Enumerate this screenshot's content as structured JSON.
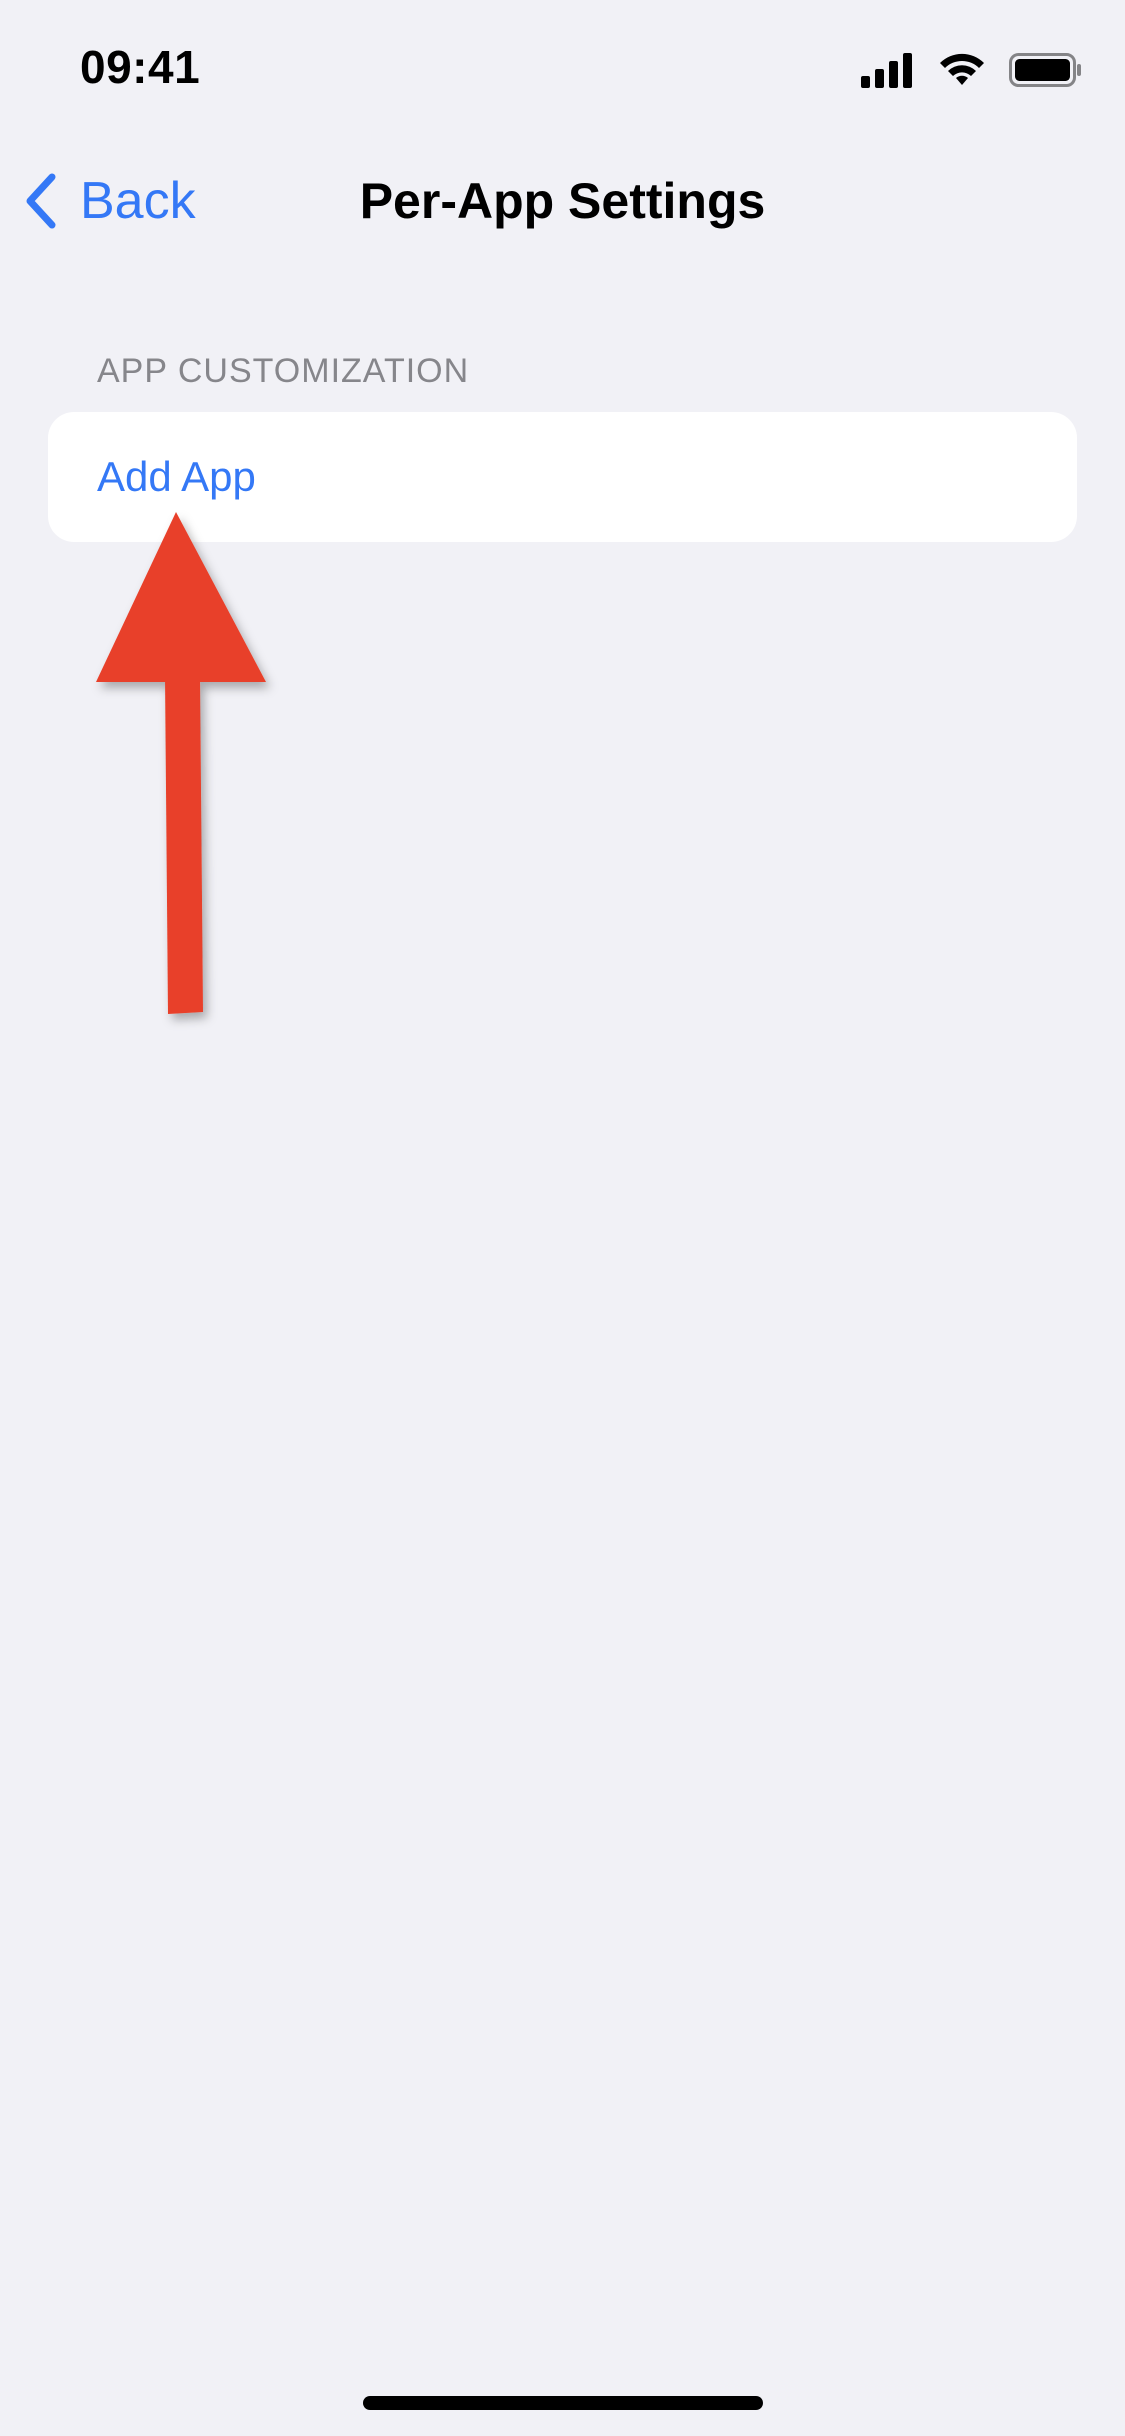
{
  "status_bar": {
    "time": "09:41",
    "icons": [
      "cellular-signal-icon",
      "wifi-icon",
      "battery-icon"
    ]
  },
  "nav": {
    "back_label": "Back",
    "title": "Per-App Settings"
  },
  "section": {
    "header": "APP CUSTOMIZATION",
    "rows": [
      {
        "label": "Add App"
      }
    ]
  },
  "colors": {
    "background": "#F1F1F6",
    "accent": "#3478F6",
    "card": "#FFFFFF",
    "section_header": "#86868B",
    "annotation_arrow": "#E8402A"
  }
}
